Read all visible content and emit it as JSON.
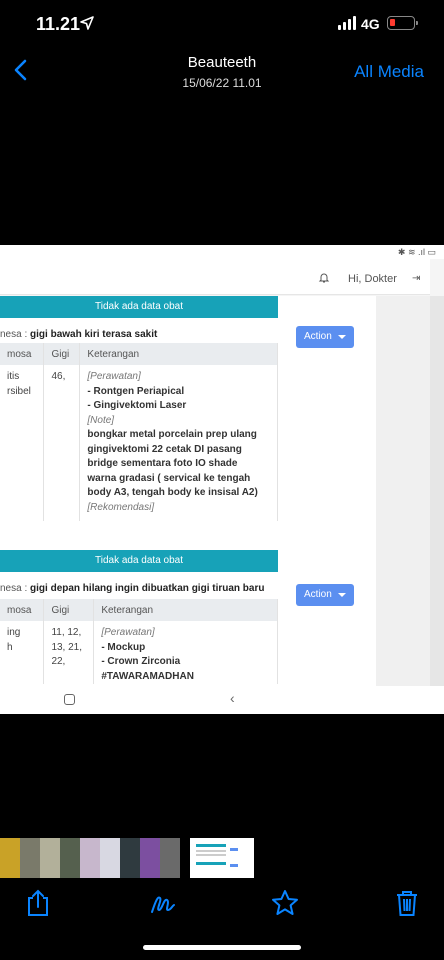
{
  "status_bar": {
    "time": "11.21",
    "network": "4G"
  },
  "nav": {
    "title": "Beauteeth",
    "subtitle": "15/06/22 11.01",
    "right_label": "All Media"
  },
  "embedded": {
    "greeting": "Hi, Dokter",
    "records": [
      {
        "banner": "Tidak ada data obat",
        "anamnesa_prefix": "nesa : ",
        "anamnesa": "gigi bawah kiri terasa sakit",
        "action_label": "Action",
        "headers": [
          "mosa",
          "Gigi",
          "Keterangan"
        ],
        "diagnosa": [
          "itis",
          "rsibel"
        ],
        "gigi": "46,",
        "lines": [
          {
            "text": "[Perawatan]",
            "style": "it"
          },
          {
            "text": "- Rontgen Periapical",
            "style": "bd"
          },
          {
            "text": "- Gingivektomi Laser",
            "style": "bd"
          },
          {
            "text": "[Note]",
            "style": "it"
          },
          {
            "text": "bongkar metal porcelain prep ulang",
            "style": "bd"
          },
          {
            "text": "gingivektomi 22 cetak DI pasang",
            "style": "bd"
          },
          {
            "text": "bridge sementara foto IO shade",
            "style": "bd"
          },
          {
            "text": "warna gradasi ( servical ke tengah",
            "style": "bd"
          },
          {
            "text": "body A3, tengah body ke insisal A2)",
            "style": "bd"
          },
          {
            "text": "[Rekomendasi]",
            "style": "it"
          }
        ]
      },
      {
        "banner": "Tidak ada data obat",
        "anamnesa_prefix": "nesa : ",
        "anamnesa": "gigi depan hilang ingin dibuatkan gigi tiruan baru",
        "action_label": "Action",
        "headers": [
          "mosa",
          "Gigi",
          "Keterangan"
        ],
        "diagnosa": [
          "ing",
          "h"
        ],
        "gigi_lines": [
          "11, 12,",
          "13, 21,",
          "22,"
        ],
        "lines": [
          {
            "text": "[Perawatan]",
            "style": "it"
          },
          {
            "text": "- Mockup",
            "style": "bd"
          },
          {
            "text": "- Crown Zirconia",
            "style": "bd"
          },
          {
            "text": "#TAWARAMADHAN",
            "style": "bd"
          }
        ]
      }
    ]
  },
  "colors": {
    "banner": "#17a2b8",
    "action": "#5b8ff0",
    "ios_blue": "#0a84ff"
  },
  "icons": [
    "location-arrow-icon",
    "signal-icon",
    "battery-icon",
    "back-chevron-icon",
    "bell-icon",
    "logout-icon",
    "share-icon",
    "markup-icon",
    "favorite-icon",
    "trash-icon"
  ]
}
